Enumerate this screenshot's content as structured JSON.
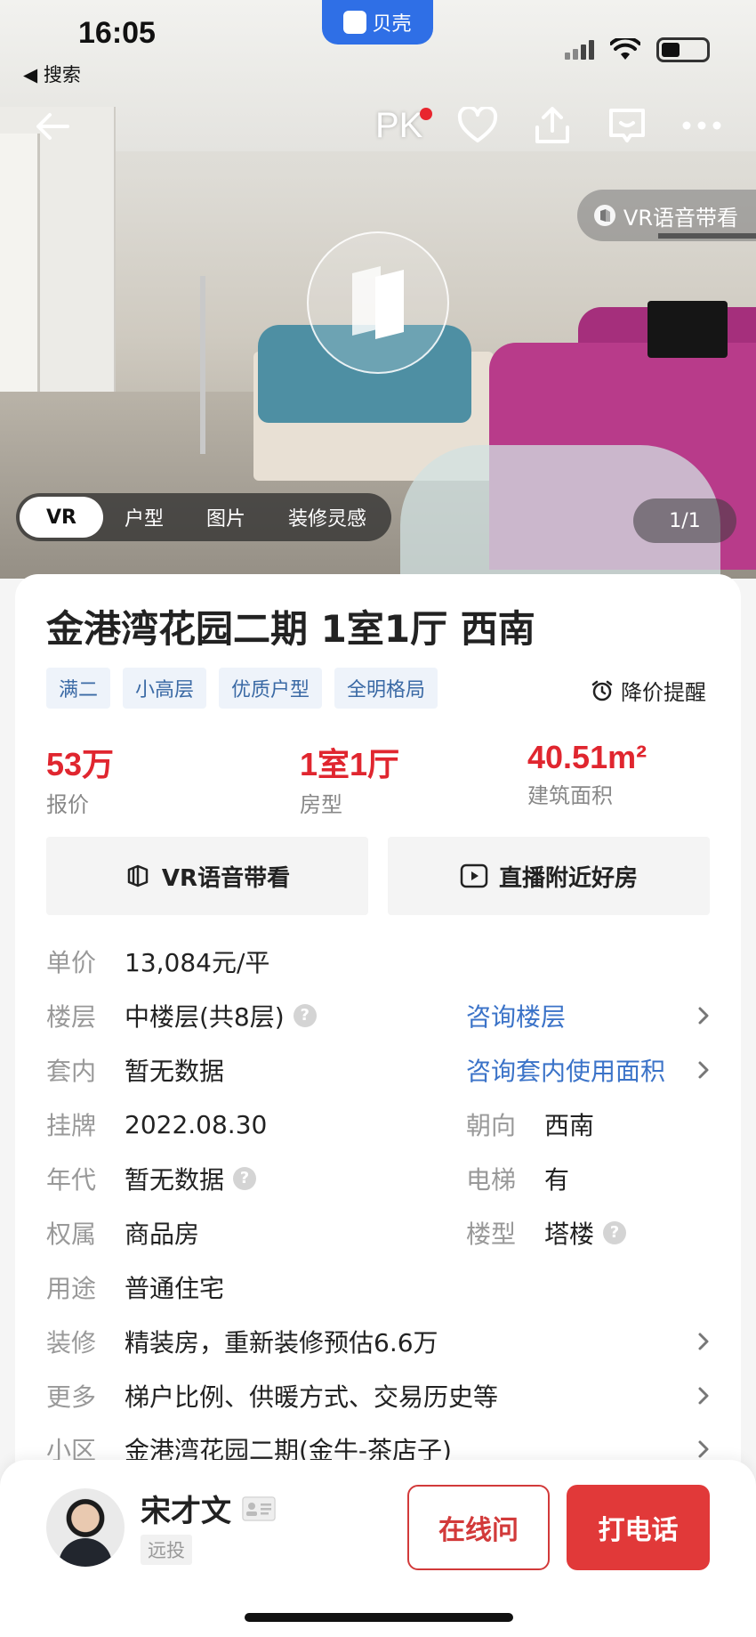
{
  "status_bar": {
    "time": "16:05",
    "back_app": "◀ 搜索",
    "app_name": "贝壳"
  },
  "nav": {
    "pk_label": "PK",
    "icons": [
      "back-arrow-icon",
      "heart-icon",
      "share-icon",
      "message-icon",
      "more-icon"
    ]
  },
  "hero": {
    "vr_voice_chip": "VR语音带看",
    "media_tabs": [
      "VR",
      "户型",
      "图片",
      "装修灵感"
    ],
    "active_tab": "VR",
    "counter": "1/1"
  },
  "listing": {
    "title": "金港湾花园二期 1室1厅 西南",
    "tags": [
      "满二",
      "小高层",
      "优质户型",
      "全明格局"
    ],
    "price_alert": "降价提醒"
  },
  "stats": [
    {
      "value": "53万",
      "label": "报价"
    },
    {
      "value": "1室1厅",
      "label": "房型"
    },
    {
      "value": "40.51m²",
      "label": "建筑面积"
    }
  ],
  "actions": {
    "vr_voice": "VR语音带看",
    "live": "直播附近好房"
  },
  "details": {
    "unit_price": {
      "key": "单价",
      "value": "13,084元/平"
    },
    "floor": {
      "key": "楼层",
      "value": "中楼层(共8层)",
      "link": "咨询楼层"
    },
    "inner": {
      "key": "套内",
      "value": "暂无数据",
      "link": "咨询套内使用面积"
    },
    "listing_date": {
      "key": "挂牌",
      "value": "2022.08.30"
    },
    "orientation": {
      "key": "朝向",
      "value": "西南"
    },
    "era": {
      "key": "年代",
      "value": "暂无数据"
    },
    "elevator": {
      "key": "电梯",
      "value": "有"
    },
    "ownership": {
      "key": "权属",
      "value": "商品房"
    },
    "building_type": {
      "key": "楼型",
      "value": "塔楼"
    },
    "usage": {
      "key": "用途",
      "value": "普通住宅"
    },
    "decoration": {
      "key": "装修",
      "value": "精装房，重新装修预估6.6万"
    },
    "more": {
      "key": "更多",
      "value": "梯户比例、供暖方式、交易历史等"
    },
    "community": {
      "key": "小区",
      "value": "金港湾花园二期(金牛-茶店子)"
    }
  },
  "agent": {
    "name": "宋才文",
    "tag": "远投",
    "online_button": "在线问",
    "call_button": "打电话"
  },
  "colors": {
    "price_red": "#e0262f",
    "link_blue": "#3b73c8",
    "call_red": "#e13939",
    "app_blue": "#2f6fe6"
  }
}
